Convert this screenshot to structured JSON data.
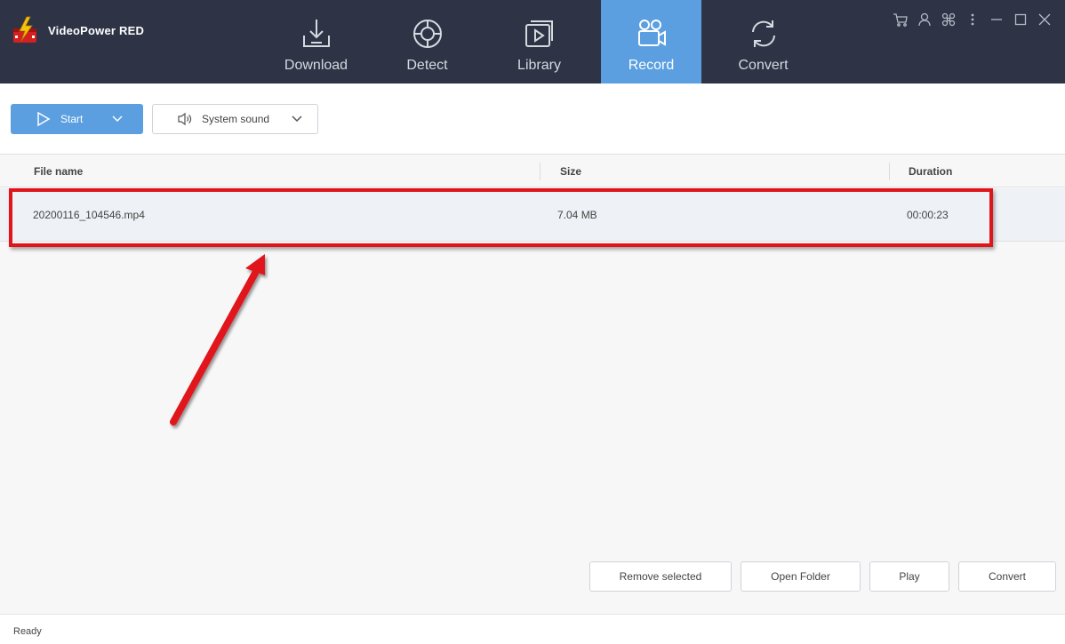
{
  "app": {
    "title": "VideoPower RED"
  },
  "nav": {
    "tabs": [
      {
        "label": "Download",
        "icon": "download-icon"
      },
      {
        "label": "Detect",
        "icon": "crosshair-icon"
      },
      {
        "label": "Library",
        "icon": "library-icon"
      },
      {
        "label": "Record",
        "icon": "camera-icon",
        "active": true
      },
      {
        "label": "Convert",
        "icon": "convert-icon"
      }
    ]
  },
  "window_icons": [
    "cart-icon",
    "user-icon",
    "command-icon",
    "more-icon",
    "minimize-icon",
    "maximize-icon",
    "close-icon"
  ],
  "toolbar": {
    "start_label": "Start",
    "sound_label": "System sound"
  },
  "table": {
    "columns": [
      "File name",
      "Size",
      "Duration"
    ],
    "rows": [
      {
        "file_name": "20200116_104546.mp4",
        "size": "7.04 MB",
        "duration": "00:00:23"
      }
    ]
  },
  "actions": {
    "remove_selected": "Remove selected",
    "open_folder": "Open Folder",
    "play": "Play",
    "convert": "Convert"
  },
  "status": {
    "text": "Ready"
  },
  "colors": {
    "topbar": "#2e3446",
    "accent": "#5b9fe0",
    "highlight": "#e0141b"
  }
}
